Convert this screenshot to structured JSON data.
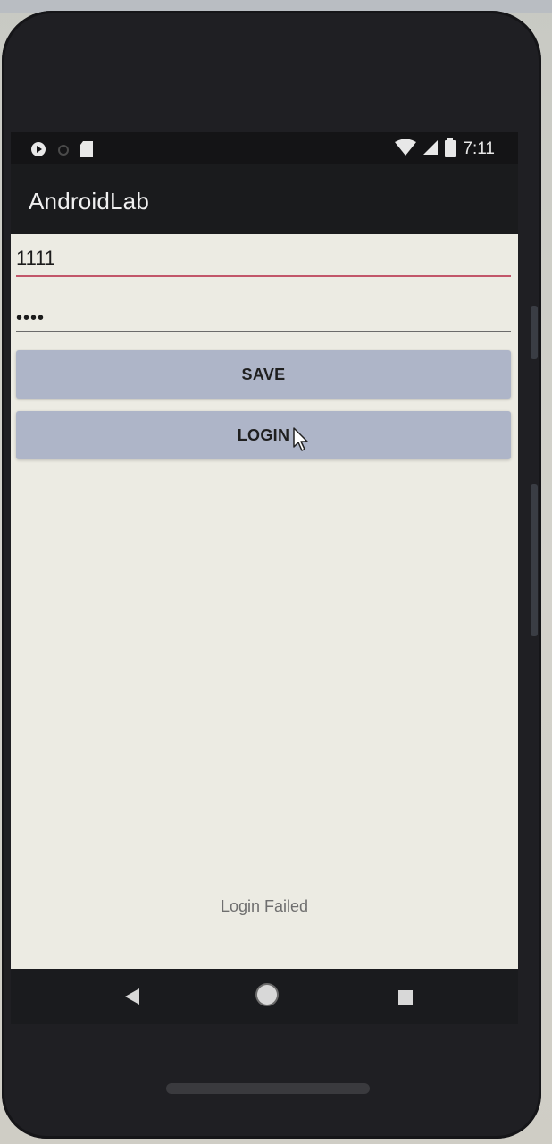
{
  "status_bar": {
    "time": "7:11",
    "icons": [
      "play-protect-icon",
      "sync-icon",
      "sd-card-icon",
      "wifi-icon",
      "signal-icon",
      "battery-icon"
    ]
  },
  "app_bar": {
    "title": "AndroidLab"
  },
  "form": {
    "username_value": "1111",
    "password_value": "••••",
    "save_label": "SAVE",
    "login_label": "LOGIN"
  },
  "toast": {
    "message": "Login Failed"
  },
  "nav_bar": {
    "icons": [
      "back-icon",
      "home-icon",
      "recents-icon"
    ]
  },
  "colors": {
    "accent_underline": "#c2566a",
    "button_bg": "#aeb5c8",
    "app_bar_bg": "#1a1b1d"
  }
}
